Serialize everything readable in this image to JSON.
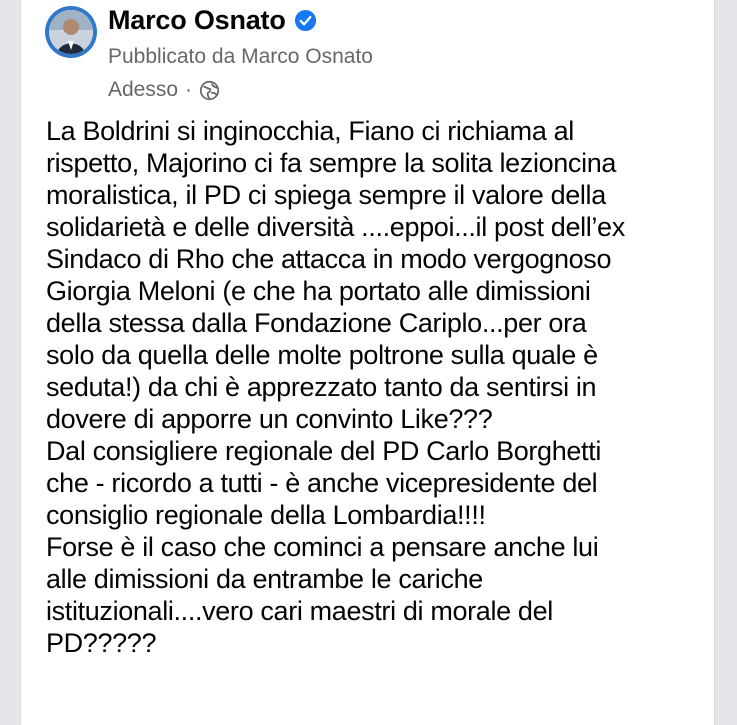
{
  "post": {
    "author": "Marco Osnato",
    "published_by": "Pubblicato da Marco Osnato",
    "timestamp": "Adesso",
    "separator": "·",
    "privacy_icon": "globe-icon",
    "verified_icon": "verified-badge-icon",
    "lines": [
      "La Boldrini si inginocchia, Fiano ci richiama al",
      "rispetto, Majorino ci fa sempre la solita leziоncina",
      "moralistica, il PD ci spiega sempre il valore della",
      "solidarietà e delle diversità ....eppoi...il post dell’ex",
      "Sindaco di Rho che attacca in modo vergognoso",
      "Giorgia Meloni (e che ha portato alle dimissioni",
      "della stessa dalla Fondazione Cariplo...per ora",
      "solo da quella delle molte poltrone sulla quale è",
      "seduta!) da chi è apprezzato tanto da sentirsi in",
      "dovere di apporre un convinto Like???",
      "Dal consigliere regionale del PD Carlo Borghetti",
      "che - ricordo a tutti - è anche vicepresidente del",
      "consiglio regionale della Lombardia!!!!",
      "Forse è il caso che cominci a pensare anche lui",
      "alle dimissioni da entrambe le cariche",
      "istituzionali....vero cari maestri di morale del",
      "PD?????"
    ]
  },
  "colors": {
    "brand_blue": "#1877f2",
    "secondary_text": "#65676b",
    "primary_text": "#050505",
    "avatar_ring": "#2f79c8"
  }
}
